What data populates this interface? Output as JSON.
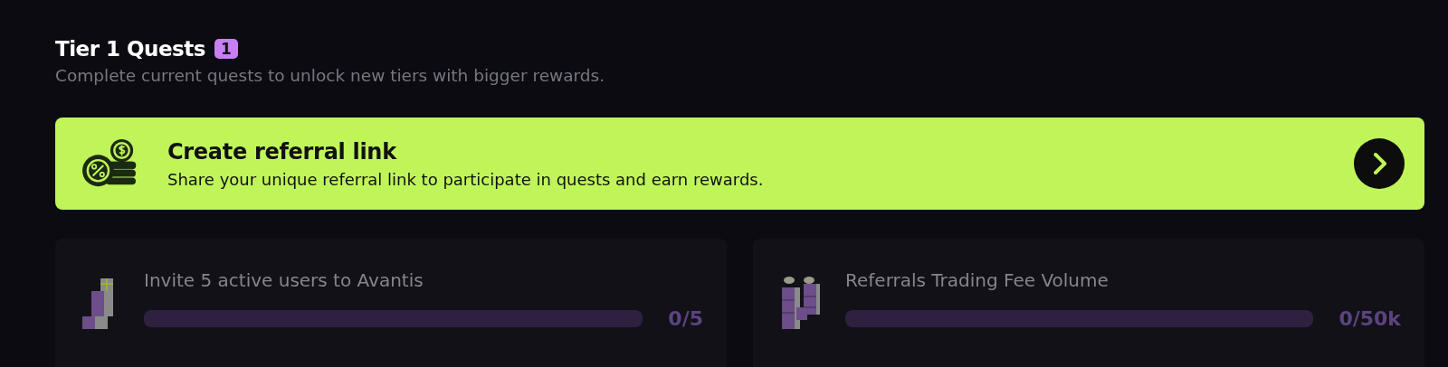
{
  "header": {
    "title": "Tier 1 Quests",
    "badge": "1",
    "subtitle": "Complete current quests to unlock new tiers with bigger rewards."
  },
  "banner": {
    "title": "Create referral link",
    "description": "Share your unique referral link to participate in quests and earn rewards."
  },
  "quests": [
    {
      "title": "Invite 5 active users to Avantis",
      "level": 0,
      "count": "0/5"
    },
    {
      "title": "Referrals Trading Fee Volume",
      "level": 0,
      "count": "0/50k"
    }
  ]
}
